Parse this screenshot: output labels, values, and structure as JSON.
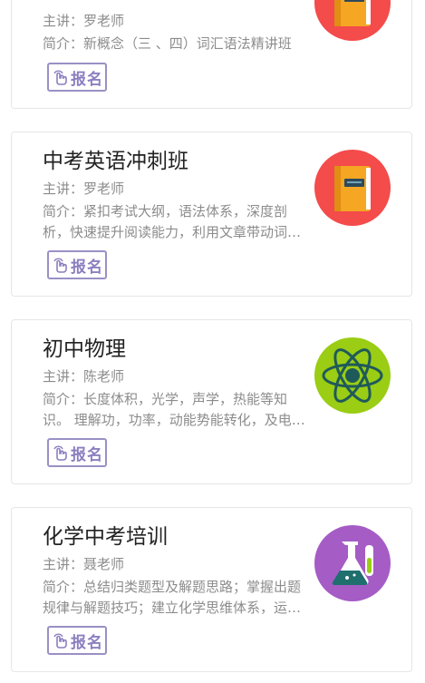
{
  "courses": [
    {
      "title": "",
      "teacher": "主讲：罗老师",
      "intro": "简介：新概念（三 、四）词汇语法精讲班",
      "button": "报名",
      "icon": "book-icon",
      "icon_bg": "#f44b4b"
    },
    {
      "title": "中考英语冲刺班",
      "teacher": "主讲：罗老师",
      "intro": "简介：紧扣考试大纲，语法体系，深度剖析，快速提升阅读能力，利用文章带动词汇积累",
      "button": "报名",
      "icon": "book-icon",
      "icon_bg": "#f44b4b"
    },
    {
      "title": "初中物理",
      "teacher": "主讲：陈老师",
      "intro": "简介：长度体积，光学，声学，热能等知识。 理解功，功率，动能势能转化，及电学知识",
      "button": "报名",
      "icon": "atom-icon",
      "icon_bg": "#9acd14"
    },
    {
      "title": "化学中考培训",
      "teacher": "主讲：聂老师",
      "intro": "简介：总结归类题型及解题思路；掌握出题规律与解题技巧；建立化学思维体系，运用知识解决问题",
      "button": "报名",
      "icon": "flask-icon",
      "icon_bg": "#a55cc5"
    }
  ]
}
